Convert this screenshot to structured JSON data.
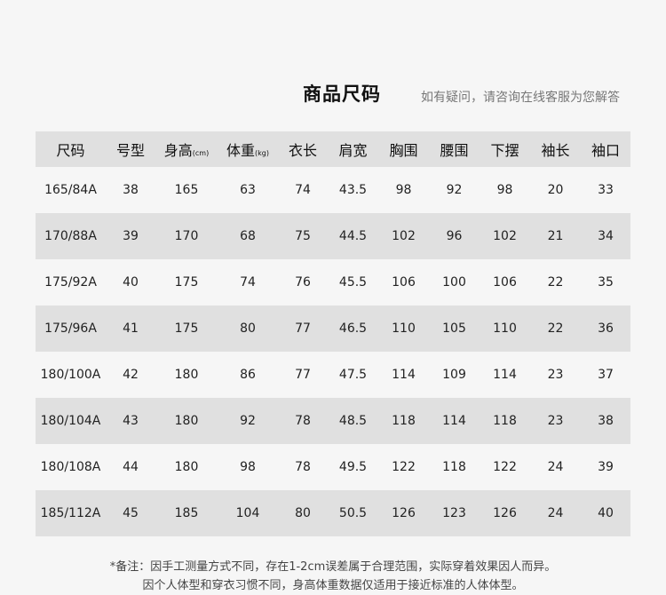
{
  "header": {
    "title": "商品尺码",
    "subtitle": "如有疑问，请咨询在线客服为您解答"
  },
  "table": {
    "columns": [
      {
        "label": "尺码",
        "unit": ""
      },
      {
        "label": "号型",
        "unit": ""
      },
      {
        "label": "身高",
        "unit": "(cm)"
      },
      {
        "label": "体重",
        "unit": "(kg)"
      },
      {
        "label": "衣长",
        "unit": ""
      },
      {
        "label": "肩宽",
        "unit": ""
      },
      {
        "label": "胸围",
        "unit": ""
      },
      {
        "label": "腰围",
        "unit": ""
      },
      {
        "label": "下摆",
        "unit": ""
      },
      {
        "label": "袖长",
        "unit": ""
      },
      {
        "label": "袖口",
        "unit": ""
      }
    ],
    "rows": [
      [
        "165/84A",
        "38",
        "165",
        "63",
        "74",
        "43.5",
        "98",
        "92",
        "98",
        "20",
        "33"
      ],
      [
        "170/88A",
        "39",
        "170",
        "68",
        "75",
        "44.5",
        "102",
        "96",
        "102",
        "21",
        "34"
      ],
      [
        "175/92A",
        "40",
        "175",
        "74",
        "76",
        "45.5",
        "106",
        "100",
        "106",
        "22",
        "35"
      ],
      [
        "175/96A",
        "41",
        "175",
        "80",
        "77",
        "46.5",
        "110",
        "105",
        "110",
        "22",
        "36"
      ],
      [
        "180/100A",
        "42",
        "180",
        "86",
        "77",
        "47.5",
        "114",
        "109",
        "114",
        "23",
        "37"
      ],
      [
        "180/104A",
        "43",
        "180",
        "92",
        "78",
        "48.5",
        "118",
        "114",
        "118",
        "23",
        "38"
      ],
      [
        "180/108A",
        "44",
        "180",
        "98",
        "78",
        "49.5",
        "122",
        "118",
        "122",
        "24",
        "39"
      ],
      [
        "185/112A",
        "45",
        "185",
        "104",
        "80",
        "50.5",
        "126",
        "123",
        "126",
        "24",
        "40"
      ]
    ]
  },
  "notes": {
    "line1": "*备注：因手工测量方式不同，存在1-2cm误差属于合理范围，实际穿着效果因人而异。",
    "line2": "因个人体型和穿衣习惯不同，身高体重数据仅适用于接近标准的人体体型。"
  }
}
